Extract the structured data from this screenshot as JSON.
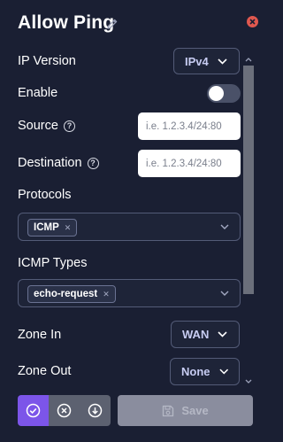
{
  "header": {
    "title": "Allow Ping",
    "edit_icon": "pencil-icon",
    "close_icon": "close-circle-icon"
  },
  "fields": {
    "ip_version": {
      "label": "IP Version",
      "value": "IPv4"
    },
    "enable": {
      "label": "Enable",
      "checked": false
    },
    "source": {
      "label": "Source",
      "placeholder": "i.e. 1.2.3.4/24:80"
    },
    "destination": {
      "label": "Destination",
      "placeholder": "i.e. 1.2.3.4/24:80"
    },
    "protocols": {
      "label": "Protocols",
      "tags": [
        "ICMP"
      ]
    },
    "icmp_types": {
      "label": "ICMP Types",
      "tags": [
        "echo-request"
      ]
    },
    "zone_in": {
      "label": "Zone In",
      "value": "WAN"
    },
    "zone_out": {
      "label": "Zone Out",
      "value": "None"
    }
  },
  "footer": {
    "save_label": "Save"
  },
  "colors": {
    "background": "#1a1f33",
    "accent": "#7c55e9",
    "danger": "#e0584f",
    "border": "#535b77"
  }
}
